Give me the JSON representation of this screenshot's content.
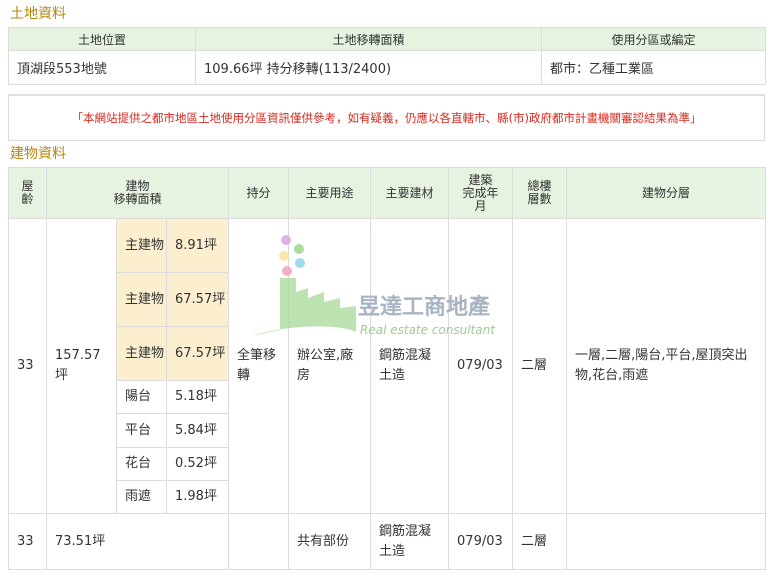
{
  "land_section": {
    "title": "土地資料",
    "headers": [
      "土地位置",
      "土地移轉面積",
      "使用分區或編定"
    ],
    "row": [
      "頂湖段553地號",
      "109.66坪 持分移轉(113/2400)",
      "都市：乙種工業區"
    ]
  },
  "notice": "「本網站提供之都市地區土地使用分區資訊僅供參考，如有疑義，仍應以各直轄市、縣(市)政府都市計畫機關審認結果為準」",
  "building_section": {
    "title": "建物資料",
    "headers": {
      "age": "屋齡",
      "area_line1": "建物",
      "area_line2": "移轉面積",
      "share": "持分",
      "use": "主要用途",
      "material": "主要建材",
      "completion_line1": "建築",
      "completion_line2": "完成年",
      "completion_line3": "月",
      "floors_line1": "總樓",
      "floors_line2": "層數",
      "division": "建物分層"
    },
    "rows": [
      {
        "age": "33",
        "area": "157.57坪",
        "sub_items": [
          {
            "label": "主建物",
            "value": "8.91坪"
          },
          {
            "label": "主建物",
            "value": "67.57坪"
          },
          {
            "label": "主建物",
            "value": "67.57坪"
          },
          {
            "label": "陽台",
            "value": "5.18坪"
          },
          {
            "label": "平台",
            "value": "5.84坪"
          },
          {
            "label": "花台",
            "value": "0.52坪"
          },
          {
            "label": "雨遮",
            "value": "1.98坪"
          }
        ],
        "share": "全筆移轉",
        "use": "辦公室,廠房",
        "material": "鋼筋混凝土造",
        "completion": "079/03",
        "floors": "二層",
        "division": "一層,二層,陽台,平台,屋頂突出物,花台,雨遮"
      },
      {
        "age": "33",
        "area": "73.51坪",
        "share": "",
        "use": "共有部份",
        "material": "鋼筋混凝土造",
        "completion": "079/03",
        "floors": "二層",
        "division": ""
      }
    ]
  },
  "watermark": {
    "name": "昱達工商地產",
    "subtitle": "Real estate consultant"
  },
  "colors": {
    "section_title": "#b8860b",
    "header_bg": "#e5f3e0",
    "sub_bg": "#fbefcf",
    "notice_text": "#d9281e"
  }
}
